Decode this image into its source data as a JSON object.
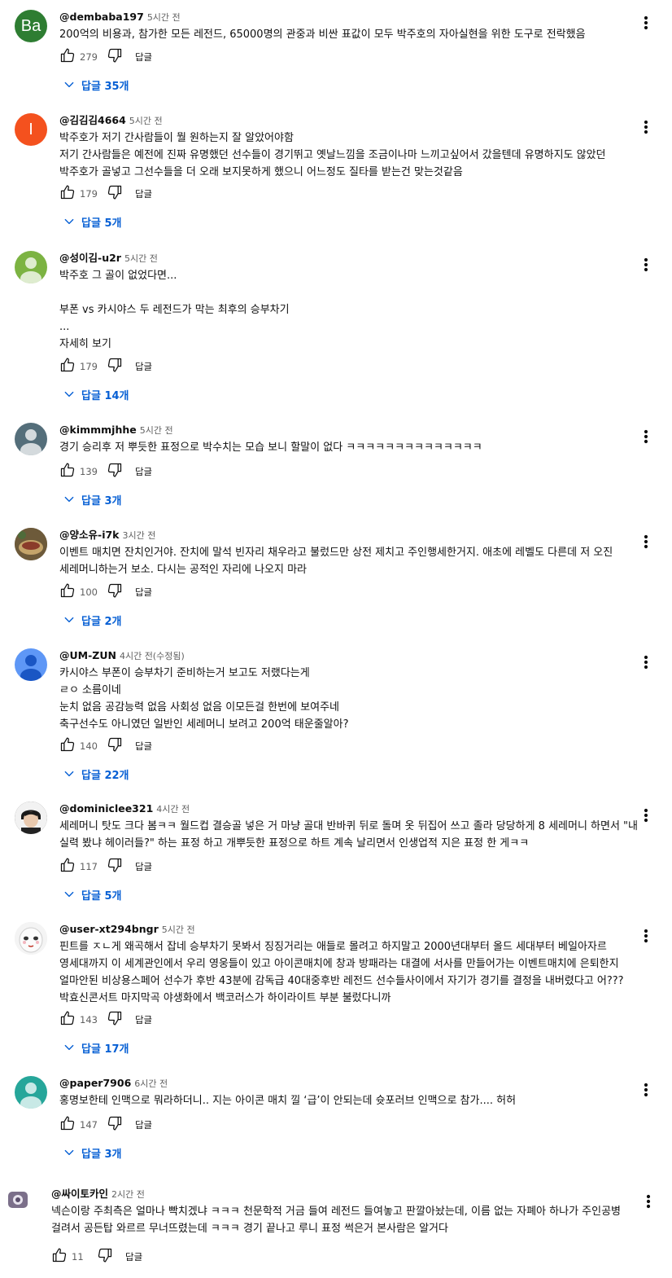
{
  "comments": [
    {
      "author": "@dembaba197",
      "time": "5시간 전",
      "avatar_text": "Ba",
      "avatar_color": "#2e7d32",
      "avatar_kind": "text",
      "text": "200억의 비용과, 참가한 모든 레전드, 65000명의 관중과 비싼 표값이 모두 박주호의 자아실현을 위한 도구로 전락했음",
      "likes": "279",
      "reply_label": "답글",
      "replies_label": "답글 35개"
    },
    {
      "author": "@김김김4664",
      "time": "5시간 전",
      "avatar_text": "I",
      "avatar_color": "#f4511e",
      "avatar_kind": "text",
      "text": "박주호가 저기 간사람들이 뭘 원하는지 잘 알았어야함\n저기 간사람들은 예전에 진짜 유명했던 선수들이 경기뛰고 옛날느낌을 조금이나마 느끼고싶어서 갔을텐데 유명하지도 않았던 박주호가 골넣고 그선수들을 더 오래 보지못하게 했으니 어느정도 질타를 받는건 맞는것같음",
      "likes": "179",
      "reply_label": "답글",
      "replies_label": "답글 5개"
    },
    {
      "author": "@성이김-u2r",
      "time": "5시간 전",
      "avatar_color": "#7cb342",
      "avatar_kind": "person",
      "text": "박주호 그 골이 없었다면...\n\n부폰 vs 카시야스 두 레전드가 막는 최후의 승부차기\n...",
      "read_more": "자세히 보기",
      "likes": "179",
      "reply_label": "답글",
      "replies_label": "답글 14개"
    },
    {
      "author": "@kimmmjhhe",
      "time": "5시간 전",
      "avatar_color": "#546e7a",
      "avatar_kind": "person",
      "text": "경기 승리후 저 뿌듯한 표정으로 박수치는 모습 보니 할말이 없다 ㅋㅋㅋㅋㅋㅋㅋㅋㅋㅋㅋㅋㅋㅋ",
      "likes": "139",
      "reply_label": "답글",
      "replies_label": "답글 3개"
    },
    {
      "author": "@양소유-i7k",
      "time": "3시간 전",
      "avatar_color": "#6d5a3a",
      "avatar_kind": "photo",
      "text": "이벤트 매치면 잔치인거야. 잔치에 말석 빈자리 채우라고 불렀드만 상전 제치고 주인행세한거지. 애초에 레벨도 다른데 저 오진 세레머니하는거 보소. 다시는 공적인 자리에 나오지 마라",
      "likes": "100",
      "reply_label": "답글",
      "replies_label": "답글 2개"
    },
    {
      "author": "@UM-ZUN",
      "time": "4시간 전(수정됨)",
      "avatar_color": "#5e97f6",
      "avatar_kind": "person-blue",
      "text": "카시야스 부폰이 승부차기 준비하는거 보고도 저랬다는게\nㄹㅇ 소름이네\n눈치 없음 공감능력 없음 사회성 없음  이모든걸 한번에 보여주네\n축구선수도 아니였던 일반인 세레머니 보려고 200억 태운줄알아?",
      "likes": "140",
      "reply_label": "답글",
      "replies_label": "답글 22개"
    },
    {
      "author": "@dominiclee321",
      "time": "4시간 전",
      "avatar_color": "#3a3a3a",
      "avatar_kind": "photo-face",
      "text": "세레머니 탓도 크다 봄ㅋㅋ 월드컵 결승골 넣은 거 마냥 골대 반바퀴 뒤로 돌며 옷 뒤집어 쓰고 졸라 당당하게 8 세레머니 하면서 \"내 실력 봤냐 헤이러들?\" 하는 표정 하고 개뿌듯한 표정으로 하트 계속 날리면서 인생업적 지은 표정 한 게ㅋㅋ",
      "likes": "117",
      "reply_label": "답글",
      "replies_label": "답글 5개"
    },
    {
      "author": "@user-xt294bngr",
      "time": "5시간 전",
      "avatar_color": "#e8e8e8",
      "avatar_kind": "doll",
      "text": "핀트를 ㅈㄴ게 왜곡해서 잡네 승부차기 못봐서 징징거리는 애들로 몰려고 하지말고 2000년대부터 올드 세대부터 베일아자르 영세대까지 이 세계관인에서 우리 영웅들이 있고 아이콘매치에 창과 방패라는 대결에 서사를 만들어가는 이벤트매치에 은퇴한지 얼마안된 비상용스페어 선수가 후반 43분에 감독급 40대중후반 레전드 선수들사이에서 자기가 경기를 결정을 내버렸다고 어??? 박효신콘서트 마지막곡 야생화에서 백코러스가 하이라이트 부분 불렀다니까",
      "likes": "143",
      "reply_label": "답글",
      "replies_label": "답글 17개"
    },
    {
      "author": "@paper7906",
      "time": "6시간 전",
      "avatar_color": "#26a69a",
      "avatar_kind": "person",
      "text": "홍명보한테 인맥으로 뭐라하더니.. 지는 아이콘 매치 낄 ‘급’이 안되는데 슛포러브 인맥으로 참가.... 허허",
      "likes": "147",
      "reply_label": "답글",
      "replies_label": "답글 3개"
    },
    {
      "author": "@싸이토카인",
      "time": "2시간 전",
      "avatar_color": "#7b6f8a",
      "avatar_kind": "cam",
      "text": "넥슨이랑 주최측은 얼마나 빡치겠냐 ㅋㅋㅋ 천문학적 거금 들여 레전드 들여놓고 판깔아놨는데, 이름 없는 자폐아 하나가 주인공병 걸려서 공든탑 와르르 무너뜨렸는데 ㅋㅋㅋ 경기 끝나고 루니 표정 썩은거 본사람은 알거다",
      "likes": "11",
      "reply_label": "답글"
    }
  ]
}
